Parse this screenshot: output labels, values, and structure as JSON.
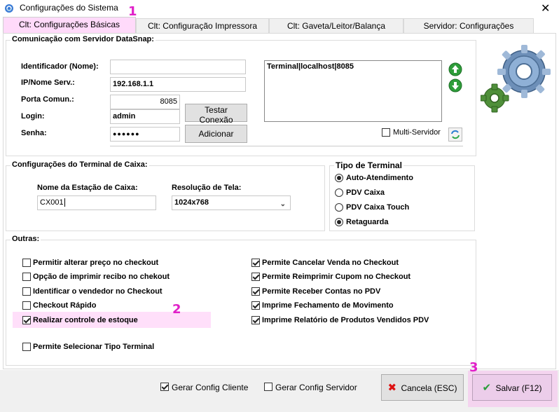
{
  "window": {
    "title": "Configurações do Sistema",
    "close_icon": "close-icon"
  },
  "tabs": [
    {
      "label": "Clt: Configurações Básicas"
    },
    {
      "label": "Clt: Configuração Impressora"
    },
    {
      "label": "Clt: Gaveta/Leitor/Balança"
    },
    {
      "label": "Servidor: Configurações"
    }
  ],
  "server": {
    "title": "Comunicação com Servidor DataSnap:",
    "identificador_label": "Identificador (Nome):",
    "identificador_value": "",
    "ip_label": "IP/Nome Serv.:",
    "ip_value": "192.168.1.1",
    "porta_label": "Porta Comun.:",
    "porta_value": "8085",
    "login_label": "Login:",
    "login_value": "admin",
    "senha_label": "Senha:",
    "senha_value": "●●●●●●",
    "test_button": "Testar Conexão",
    "add_button": "Adicionar",
    "list_items": [
      "Terminal|localhost|8085"
    ],
    "multi_servidor_label": "Multi-Servidor",
    "multi_servidor_checked": false
  },
  "terminal": {
    "title": "Configurações do Terminal de Caixa:",
    "estacao_label": "Nome da Estação de Caixa:",
    "estacao_value": "CX001",
    "resolucao_label": "Resolução de Tela:",
    "resolucao_value": "1024x768"
  },
  "tipo_terminal": {
    "title": "Tipo de Terminal",
    "options": [
      {
        "label": "Auto-Atendimento",
        "selected": true
      },
      {
        "label": "PDV Caixa",
        "selected": false
      },
      {
        "label": "PDV Caixa Touch",
        "selected": false
      },
      {
        "label": "Retaguarda",
        "selected": true
      }
    ]
  },
  "outras": {
    "title": "Outras:",
    "left": [
      {
        "label": "Permitir alterar preço no checkout",
        "checked": false
      },
      {
        "label": "Opção de imprimir recibo no chekout",
        "checked": false
      },
      {
        "label": "Identificar o vendedor no Checkout",
        "checked": false
      },
      {
        "label": "Checkout Rápido",
        "checked": false
      },
      {
        "label": "Realizar controle de estoque",
        "checked": true
      },
      {
        "label": "Permite Selecionar Tipo Terminal",
        "checked": false
      }
    ],
    "right": [
      {
        "label": "Permite Cancelar Venda no Checkout",
        "checked": true
      },
      {
        "label": "Permite Reimprimir Cupom no Checkout",
        "checked": true
      },
      {
        "label": "Permite Receber Contas no PDV",
        "checked": true
      },
      {
        "label": "Imprime Fechamento de Movimento",
        "checked": true
      },
      {
        "label": "Imprime Relatório de Produtos Vendidos PDV",
        "checked": true
      }
    ]
  },
  "footer": {
    "gerar_cliente_label": "Gerar Config Cliente",
    "gerar_cliente_checked": true,
    "gerar_servidor_label": "Gerar Config Servidor",
    "gerar_servidor_checked": false,
    "cancel_label": "Cancela (ESC)",
    "save_label": "Salvar (F12)"
  },
  "markers": [
    "1",
    "2",
    "3"
  ],
  "colors": {
    "marker": "#e020c8",
    "highlight": "#ffb0f0"
  }
}
